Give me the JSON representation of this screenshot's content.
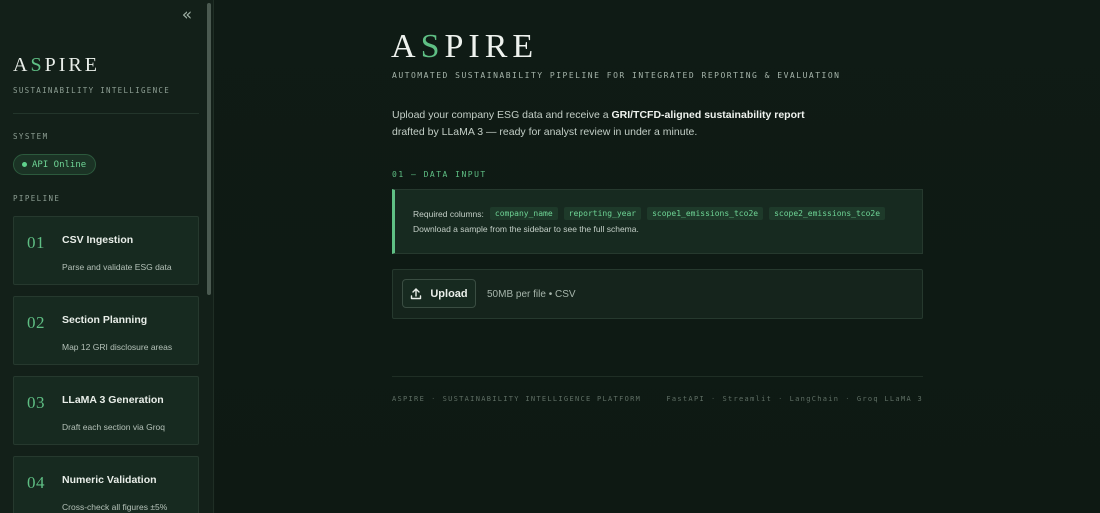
{
  "sidebar": {
    "collapse_icon": "«",
    "brand": {
      "a": "A",
      "s": "S",
      "rest": "PIRE"
    },
    "brand_subtitle": "SUSTAINABILITY INTELLIGENCE",
    "system_label": "SYSTEM",
    "api_status": "API Online",
    "pipeline_label": "PIPELINE",
    "steps": [
      {
        "num": "01",
        "title": "CSV Ingestion",
        "desc": "Parse and validate ESG data"
      },
      {
        "num": "02",
        "title": "Section Planning",
        "desc": "Map 12 GRI disclosure areas"
      },
      {
        "num": "03",
        "title": "LLaMA 3 Generation",
        "desc": "Draft each section via Groq"
      },
      {
        "num": "04",
        "title": "Numeric Validation",
        "desc": "Cross-check all figures ±5%"
      }
    ]
  },
  "main": {
    "title": {
      "a": "A",
      "s": "S",
      "rest": "PIRE"
    },
    "subtitle": "AUTOMATED SUSTAINABILITY PIPELINE FOR INTEGRATED REPORTING & EVALUATION",
    "intro": {
      "before": "Upload your company ESG data and receive a ",
      "bold": "GRI/TCFD-aligned sustainability report",
      "after": " drafted by LLaMA 3 — ready for analyst review in under a minute."
    },
    "data_input_label": "01 — DATA INPUT",
    "required_label": "Required columns:",
    "required_columns": [
      "company_name",
      "reporting_year",
      "scope1_emissions_tco2e",
      "scope2_emissions_tco2e"
    ],
    "download_note": "Download a sample from the sidebar to see the full schema.",
    "upload_label": "Upload",
    "upload_hint": "50MB per file • CSV"
  },
  "footer": {
    "left": [
      "ASPIRE",
      "SUSTAINABILITY INTELLIGENCE PLATFORM"
    ],
    "right": [
      "FastAPI",
      "Streamlit",
      "LangChain",
      "Groq LLaMA 3"
    ]
  },
  "colors": {
    "accent": "#5fbf84",
    "background": "#0f1a14",
    "sidebar": "#132019"
  }
}
